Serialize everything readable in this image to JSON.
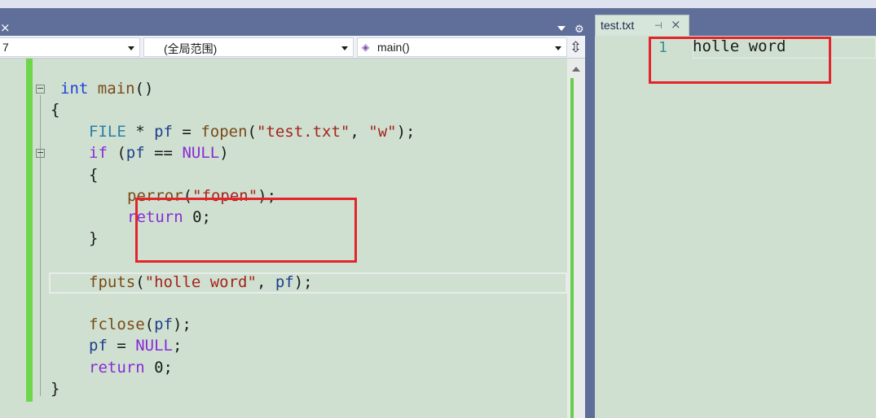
{
  "left_tab_bar": {
    "close_glyph": "×",
    "gear_glyph": "⚙"
  },
  "right_tab": {
    "label": "test.txt",
    "pin_glyph": "⊣",
    "close_glyph": "×"
  },
  "nav": {
    "project": "7",
    "scope": "(全局范围)",
    "function": "main()",
    "split_glyph": "⇳"
  },
  "code_lines": [
    [
      {
        "t": "int",
        "c": "kw"
      },
      {
        "t": " "
      },
      {
        "t": "main",
        "c": "fn"
      },
      {
        "t": "()"
      }
    ],
    [
      {
        "t": "{"
      }
    ],
    [
      {
        "t": "FILE",
        "c": "type"
      },
      {
        "t": " * "
      },
      {
        "t": "pf",
        "c": "var"
      },
      {
        "t": " = "
      },
      {
        "t": "fopen",
        "c": "fn"
      },
      {
        "t": "("
      },
      {
        "t": "\"test.txt\"",
        "c": "str"
      },
      {
        "t": ", "
      },
      {
        "t": "\"w\"",
        "c": "str"
      },
      {
        "t": ");"
      }
    ],
    [
      {
        "t": "if",
        "c": "kw2"
      },
      {
        "t": " ("
      },
      {
        "t": "pf",
        "c": "var"
      },
      {
        "t": " == "
      },
      {
        "t": "NULL",
        "c": "kw2"
      },
      {
        "t": ")"
      }
    ],
    [
      {
        "t": "{"
      }
    ],
    [
      {
        "t": "perror",
        "c": "fn"
      },
      {
        "t": "("
      },
      {
        "t": "\"fopen\"",
        "c": "str"
      },
      {
        "t": ");"
      }
    ],
    [
      {
        "t": "return",
        "c": "kw2"
      },
      {
        "t": " 0;"
      }
    ],
    [
      {
        "t": "}"
      }
    ],
    [],
    [
      {
        "t": "fputs",
        "c": "fn"
      },
      {
        "t": "("
      },
      {
        "t": "\"holle word\"",
        "c": "str"
      },
      {
        "t": ", "
      },
      {
        "t": "pf",
        "c": "var"
      },
      {
        "t": ");"
      }
    ],
    [],
    [
      {
        "t": "fclose",
        "c": "fn"
      },
      {
        "t": "("
      },
      {
        "t": "pf",
        "c": "var"
      },
      {
        "t": ");"
      }
    ],
    [
      {
        "t": "pf",
        "c": "var"
      },
      {
        "t": " = "
      },
      {
        "t": "NULL",
        "c": "kw2"
      },
      {
        "t": ";"
      }
    ],
    [
      {
        "t": "return",
        "c": "kw2"
      },
      {
        "t": " 0;"
      }
    ],
    [
      {
        "t": "}"
      }
    ]
  ],
  "right_editor": {
    "line_number": "1",
    "text": "holle word"
  }
}
